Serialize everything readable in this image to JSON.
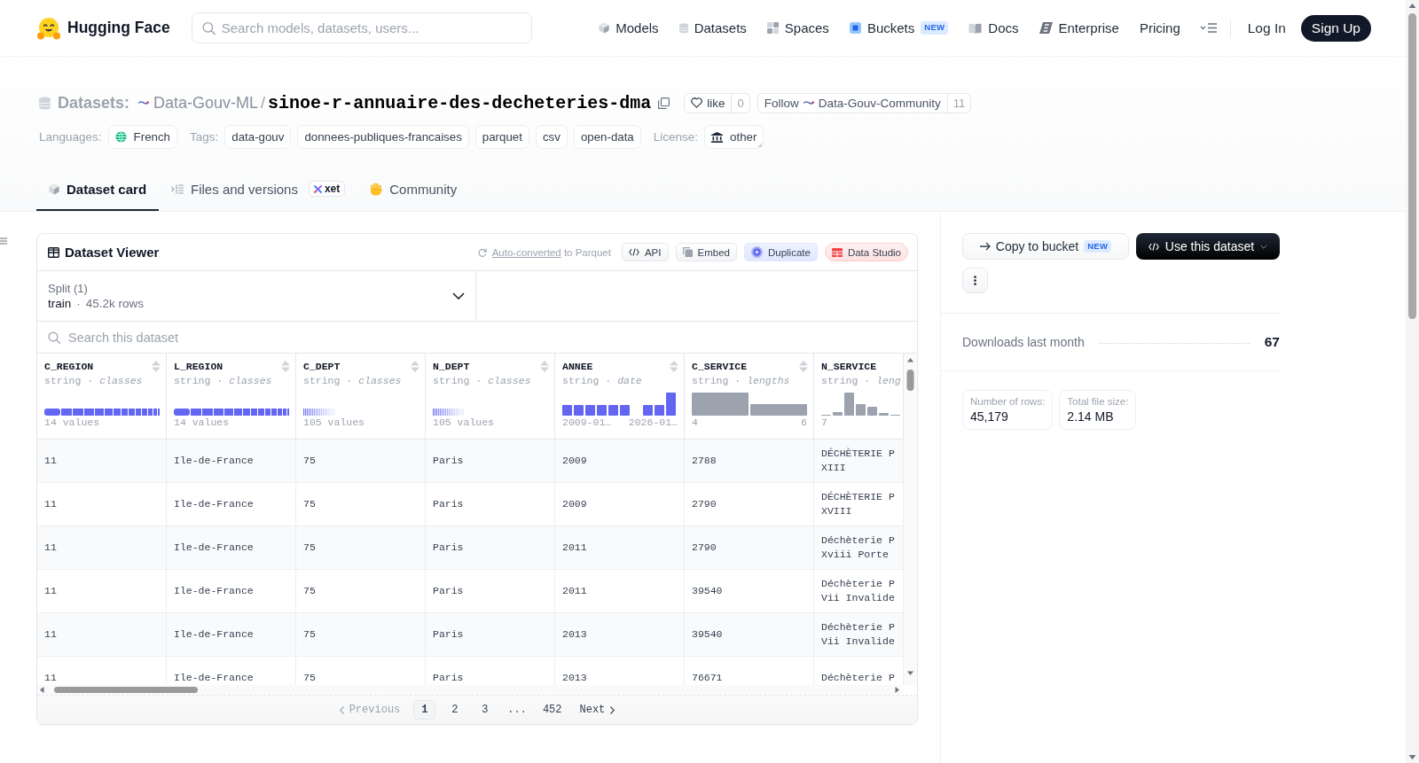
{
  "top_nav": {
    "brand": "Hugging Face",
    "search": {
      "placeholder": "Search models, datasets, users..."
    },
    "links": [
      {
        "label": "Models",
        "kind": "models"
      },
      {
        "label": "Datasets",
        "kind": "datasets"
      },
      {
        "label": "Spaces",
        "kind": "spaces"
      },
      {
        "label": "Buckets",
        "kind": "buckets",
        "badge": "NEW"
      },
      {
        "label": "Docs",
        "kind": "docs"
      },
      {
        "label": "Enterprise",
        "kind": "enterprise"
      },
      {
        "label": "Pricing",
        "kind": "plain"
      }
    ],
    "log_in": "Log In",
    "sign_up": "Sign Up"
  },
  "repo": {
    "type_label": "Datasets:",
    "owner": "Data-Gouv-ML",
    "separator": "/",
    "name": "sinoe-r-annuaire-des-decheteries-dma",
    "like": {
      "label": "like",
      "count": "0"
    },
    "follow": {
      "label": "Follow",
      "org": "Data-Gouv-Community",
      "count": "11"
    },
    "languages": {
      "label": "Languages:",
      "items": [
        "French"
      ]
    },
    "tags": {
      "label": "Tags:",
      "items": [
        "data-gouv",
        "donnees-publiques-francaises",
        "parquet",
        "csv",
        "open-data"
      ]
    },
    "license": {
      "label": "License:",
      "value": "other"
    }
  },
  "tabs": [
    {
      "label": "Dataset card",
      "kind": "card",
      "selected": true
    },
    {
      "label": "Files and versions",
      "kind": "files",
      "badge": "xet",
      "selected": false
    },
    {
      "label": "Community",
      "kind": "community",
      "selected": false
    }
  ],
  "viewer": {
    "title": "Dataset Viewer",
    "conversion": {
      "link": "Auto-converted",
      "text": "to Parquet"
    },
    "actions": [
      {
        "label": "API",
        "kind": "api"
      },
      {
        "label": "Embed",
        "kind": "embed"
      },
      {
        "label": "Duplicate",
        "kind": "duplicate"
      },
      {
        "label": "Data Studio",
        "kind": "studio"
      }
    ],
    "split": {
      "label": "Split (1)",
      "name": "train",
      "separator": "·",
      "rows": "45.2k rows"
    },
    "search": {
      "placeholder": "Search this dataset"
    },
    "columns": [
      {
        "name": "C_REGION",
        "type": "string · *classes*",
        "sortable": true,
        "summary": {
          "kind": "class_bar_few",
          "labels": [
            "14 values"
          ]
        }
      },
      {
        "name": "L_REGION",
        "type": "string · *classes*",
        "sortable": true,
        "summary": {
          "kind": "class_bar_few",
          "labels": [
            "14 values"
          ]
        }
      },
      {
        "name": "C_DEPT",
        "type": "string · *classes*",
        "sortable": true,
        "summary": {
          "kind": "class_bar_many",
          "labels": [
            "105 values"
          ]
        }
      },
      {
        "name": "N_DEPT",
        "type": "string · *classes*",
        "sortable": true,
        "summary": {
          "kind": "class_bar_many",
          "labels": [
            "105 values"
          ]
        }
      },
      {
        "name": "ANNEE",
        "type": "string · *date*",
        "sortable": true,
        "summary": {
          "kind": "histogram_date",
          "labels": [
            "2009-01…",
            "2026-01…"
          ]
        }
      },
      {
        "name": "C_SERVICE",
        "type": "string · *lengths*",
        "sortable": true,
        "summary": {
          "kind": "histogram_two_bins",
          "labels": [
            "4",
            "6"
          ]
        }
      },
      {
        "name": "N_SERVICE",
        "type": "string · *leng*",
        "sortable": false,
        "summary": {
          "kind": "histogram_skewed",
          "labels": [
            "7"
          ]
        }
      }
    ],
    "rows": [
      [
        "11",
        "Ile-de-France",
        "75",
        "Paris",
        "2009",
        "2788",
        "DÉCHÈTERIE P XIII"
      ],
      [
        "11",
        "Ile-de-France",
        "75",
        "Paris",
        "2009",
        "2790",
        "DÉCHÈTERIE P XVIII"
      ],
      [
        "11",
        "Ile-de-France",
        "75",
        "Paris",
        "2011",
        "2790",
        "Déchèterie P Xviii Porte"
      ],
      [
        "11",
        "Ile-de-France",
        "75",
        "Paris",
        "2011",
        "39540",
        "Déchèterie P Vii Invalide"
      ],
      [
        "11",
        "Ile-de-France",
        "75",
        "Paris",
        "2013",
        "39540",
        "Déchèterie P Vii Invalide"
      ],
      [
        "11",
        "Ile-de-France",
        "75",
        "Paris",
        "2013",
        "76671",
        "Déchèterie P"
      ]
    ],
    "pagination": {
      "previous": {
        "label": "Previous",
        "disabled": true
      },
      "pages": [
        {
          "label": "1",
          "kind": "page",
          "selected": true
        },
        {
          "label": "2",
          "kind": "page",
          "selected": false
        },
        {
          "label": "3",
          "kind": "page",
          "selected": false
        },
        {
          "label": "...",
          "kind": "ellipsis"
        },
        {
          "label": "452",
          "kind": "page",
          "selected": false
        }
      ],
      "next": {
        "label": "Next",
        "disabled": false
      }
    }
  },
  "sidebar": {
    "copy_button": {
      "label": "Copy to bucket",
      "badge": "NEW"
    },
    "use_button": {
      "label": "Use this dataset"
    },
    "downloads": {
      "label": "Downloads last month",
      "value": "67"
    },
    "stats": [
      {
        "label": "Number of rows:",
        "value": "45,179"
      },
      {
        "label": "Total file size:",
        "value": "2.14 MB"
      }
    ]
  }
}
